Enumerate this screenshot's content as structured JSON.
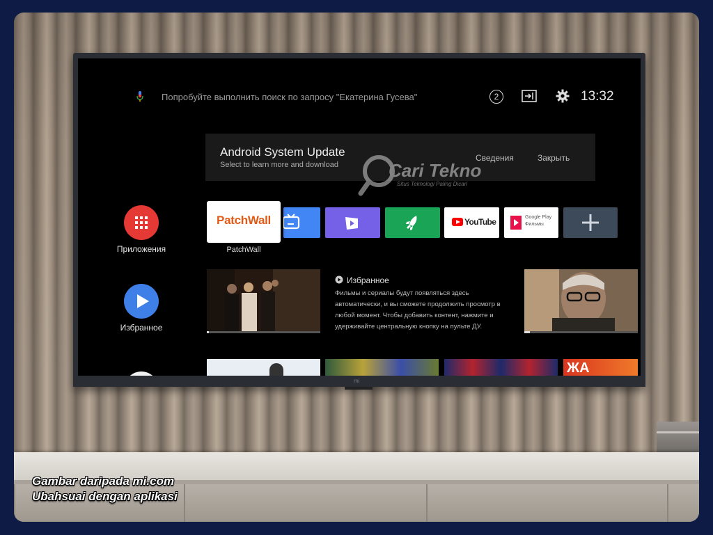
{
  "caption": {
    "line1": "Gambar daripada mi.com",
    "line2": "Ubahsuai dengan aplikasi"
  },
  "tv": {
    "brand_logo": "mi",
    "search": {
      "icon": "mic-icon",
      "hint": "Попробуйте выполнить поиск по запросу \"Екатерина Гусева\""
    },
    "status": {
      "notifications": "2",
      "clock": "13:32"
    },
    "banner": {
      "title": "Android System Update",
      "subtitle": "Select to learn more and download",
      "details_button": "Сведения",
      "close_button": "Закрыть"
    },
    "watermark": {
      "text": "Cari Tekno",
      "tagline": "Situs Teknologi Paling Dicari"
    },
    "sidebar": [
      {
        "label": "Приложения",
        "icon": "apps-grid-icon",
        "color": "#e53935"
      },
      {
        "label": "Избранное",
        "icon": "play-icon",
        "color": "#3f7fe8"
      }
    ],
    "apps_row": [
      {
        "name": "PatchWall",
        "logo_text": "PatchWall",
        "focused": true
      },
      {
        "name": "tv-app",
        "icon": "tv-icon",
        "color": "#4285f4"
      },
      {
        "name": "video-app",
        "icon": "video-play-icon",
        "color": "#7561e8"
      },
      {
        "name": "rocket-app",
        "icon": "rocket-icon",
        "color": "#1aa556"
      },
      {
        "name": "YouTube",
        "logo_text": "YouTube",
        "color": "#ff0000"
      },
      {
        "name": "Google Play Фильмы",
        "logo_line1": "Google Play",
        "logo_line2": "Фильмы",
        "color": "#e8114a"
      },
      {
        "name": "add-app",
        "icon": "plus-icon",
        "color": "#3d4a5a"
      }
    ],
    "favorites": {
      "title": "Избранное",
      "body": "Фильмы и сериалы будут появляться здесь автоматически, и вы сможете продолжить просмотр в любой момент. Чтобы добавить контент, нажмите и удерживайте центральную кнопку на пульте ДУ.",
      "left_progress": 0.02,
      "right_progress": 0.05
    },
    "bottom_row_label": "ЖА"
  }
}
